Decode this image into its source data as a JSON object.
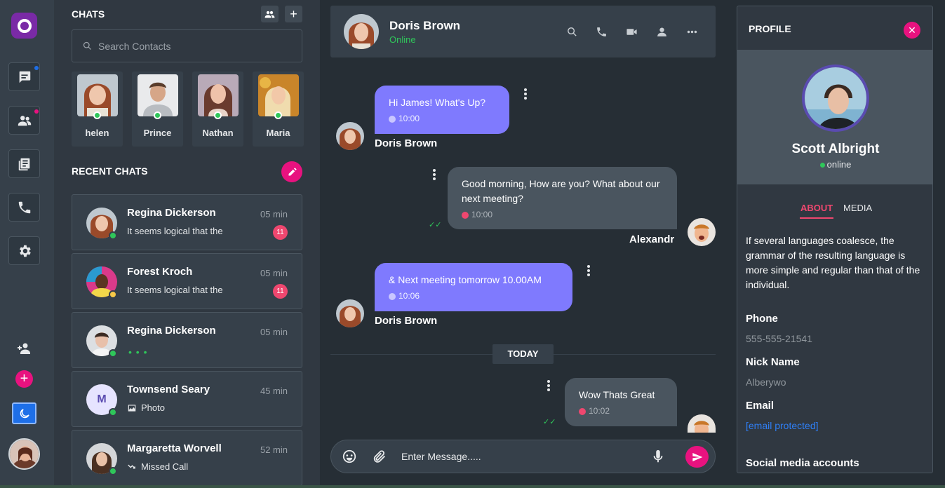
{
  "rail": {
    "icons": [
      "chat-icon",
      "contacts-icon",
      "docs-icon",
      "phone-icon",
      "settings-icon"
    ],
    "accent": "#e8127f"
  },
  "chats": {
    "title": "CHATS",
    "search_placeholder": "Search Contacts",
    "favorites": [
      {
        "name": "helen"
      },
      {
        "name": "Prince"
      },
      {
        "name": "Nathan"
      },
      {
        "name": "Maria"
      }
    ],
    "recent_title": "RECENT CHATS",
    "recent": [
      {
        "name": "Regina Dickerson",
        "time": "05 min",
        "message": "It seems logical that the",
        "unread": "11",
        "status": "online"
      },
      {
        "name": "Forest Kroch",
        "time": "05 min",
        "message": "It seems logical that the",
        "unread": "11",
        "status": "away"
      },
      {
        "name": "Regina Dickerson",
        "time": "05 min",
        "typing": "• • •",
        "status": "online"
      },
      {
        "name": "Townsend Seary",
        "time": "45 min",
        "message": "Photo",
        "initial": "M",
        "status": "online"
      },
      {
        "name": "Margaretta Worvell",
        "time": "52 min",
        "message": "Missed Call",
        "status": "online"
      }
    ]
  },
  "conversation": {
    "contact_name": "Doris Brown",
    "contact_status": "Online",
    "messages": [
      {
        "text": "Hi James! What's Up?",
        "time": "10:00",
        "sender": "Doris Brown",
        "direction": "in"
      },
      {
        "text": "Good morning, How are you? What about our next meeting?",
        "time": "10:00",
        "sender": "Alexandr",
        "direction": "out"
      },
      {
        "text": "& Next meeting tomorrow 10.00AM",
        "time": "10:06",
        "sender": "Doris Brown",
        "direction": "in"
      },
      {
        "text": "Wow Thats Great",
        "time": "10:02",
        "direction": "out"
      }
    ],
    "divider_label": "TODAY",
    "input_placeholder": "Enter Message....."
  },
  "profile": {
    "title": "PROFILE",
    "name": "Scott Albright",
    "status": "online",
    "tabs": {
      "about": "ABOUT",
      "media": "MEDIA"
    },
    "about_text": "If several languages coalesce, the grammar of the resulting language is more simple and regular than that of the individual.",
    "phone_label": "Phone",
    "phone": "555-555-21541",
    "nick_label": "Nick Name",
    "nick": "Alberywo",
    "email_label": "Email",
    "email": "[email protected]",
    "social_label": "Social media accounts"
  }
}
